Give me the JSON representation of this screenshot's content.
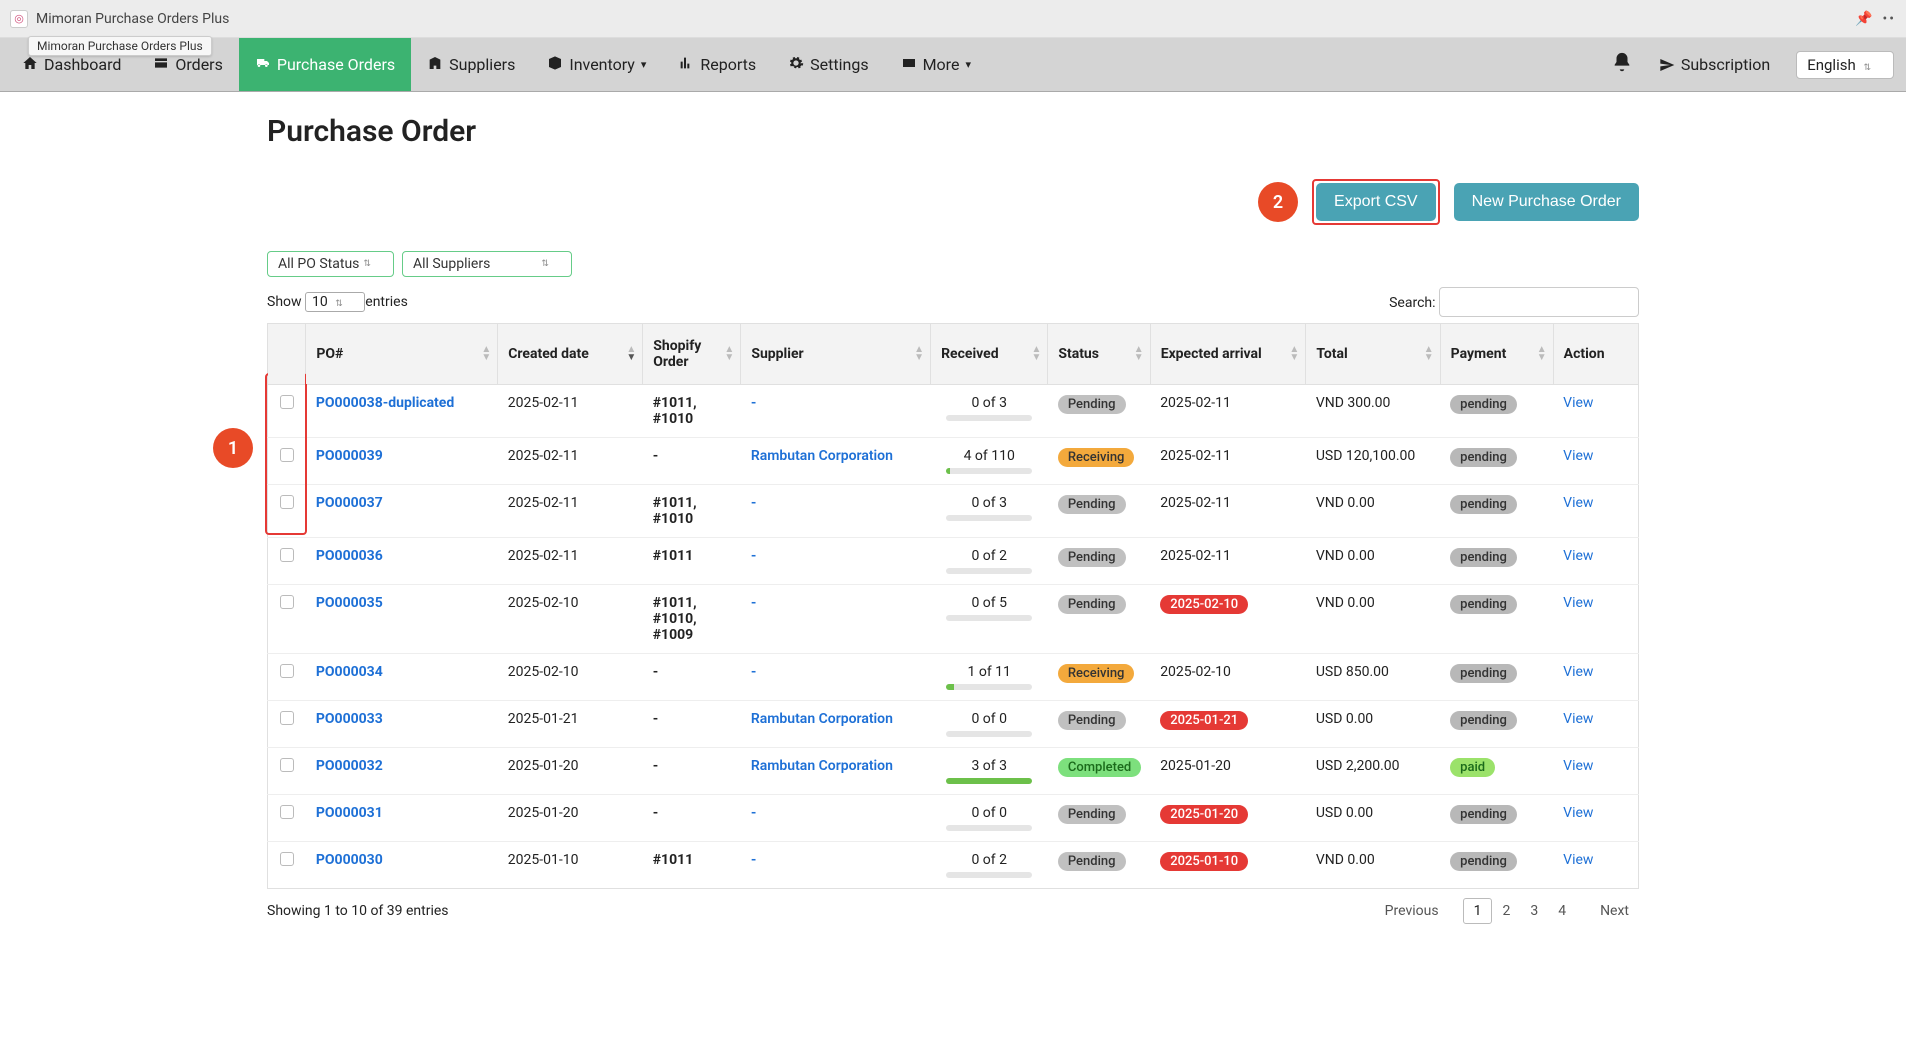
{
  "titlebar": {
    "app_title": "Mimoran Purchase Orders Plus",
    "tooltip": "Mimoran Purchase Orders Plus"
  },
  "nav": {
    "items": [
      {
        "label": "Dashboard",
        "icon": "home-icon"
      },
      {
        "label": "Orders",
        "icon": "orders-icon"
      },
      {
        "label": "Purchase Orders",
        "icon": "truck-icon",
        "active": true
      },
      {
        "label": "Suppliers",
        "icon": "building-icon"
      },
      {
        "label": "Inventory",
        "icon": "box-icon",
        "caret": true
      },
      {
        "label": "Reports",
        "icon": "chart-icon"
      },
      {
        "label": "Settings",
        "icon": "gear-icon"
      },
      {
        "label": "More",
        "icon": "card-icon",
        "caret": true
      }
    ],
    "subscription_label": "Subscription",
    "language": "English"
  },
  "page": {
    "title": "Purchase Order",
    "export_button": "Export CSV",
    "new_button": "New Purchase Order"
  },
  "annotations": {
    "a1": "1",
    "a2": "2"
  },
  "filters": {
    "status_select": "All PO Status",
    "supplier_select": "All Suppliers"
  },
  "datatable": {
    "show_label_prefix": "Show",
    "length_value": "10",
    "show_label_suffix": "entries",
    "search_label": "Search:",
    "columns": [
      "",
      "PO#",
      "Created date",
      "Shopify Order",
      "Supplier",
      "Received",
      "Status",
      "Expected arrival",
      "Total",
      "Payment",
      "Action"
    ],
    "rows": [
      {
        "po": "PO000038-duplicated",
        "created": "2025-02-11",
        "shopify": "#1011, #1010",
        "supplier": "-",
        "received_text": "0 of 3",
        "received_pct": 0,
        "status": "Pending",
        "status_class": "pending",
        "eta": "2025-02-11",
        "eta_overdue": false,
        "total": "VND 300.00",
        "payment": "pending",
        "payment_class": "pending",
        "action": "View"
      },
      {
        "po": "PO000039",
        "created": "2025-02-11",
        "shopify": "-",
        "supplier": "Rambutan Corporation",
        "received_text": "4 of 110",
        "received_pct": 4,
        "status": "Receiving",
        "status_class": "receiving",
        "eta": "2025-02-11",
        "eta_overdue": false,
        "total": "USD 120,100.00",
        "payment": "pending",
        "payment_class": "pending",
        "action": "View"
      },
      {
        "po": "PO000037",
        "created": "2025-02-11",
        "shopify": "#1011, #1010",
        "supplier": "-",
        "received_text": "0 of 3",
        "received_pct": 0,
        "status": "Pending",
        "status_class": "pending",
        "eta": "2025-02-11",
        "eta_overdue": false,
        "total": "VND 0.00",
        "payment": "pending",
        "payment_class": "pending",
        "action": "View"
      },
      {
        "po": "PO000036",
        "created": "2025-02-11",
        "shopify": "#1011",
        "supplier": "-",
        "received_text": "0 of 2",
        "received_pct": 0,
        "status": "Pending",
        "status_class": "pending",
        "eta": "2025-02-11",
        "eta_overdue": false,
        "total": "VND 0.00",
        "payment": "pending",
        "payment_class": "pending",
        "action": "View"
      },
      {
        "po": "PO000035",
        "created": "2025-02-10",
        "shopify": "#1011, #1010, #1009",
        "supplier": "-",
        "received_text": "0 of 5",
        "received_pct": 0,
        "status": "Pending",
        "status_class": "pending",
        "eta": "2025-02-10",
        "eta_overdue": true,
        "total": "VND 0.00",
        "payment": "pending",
        "payment_class": "pending",
        "action": "View"
      },
      {
        "po": "PO000034",
        "created": "2025-02-10",
        "shopify": "-",
        "supplier": "-",
        "received_text": "1 of 11",
        "received_pct": 9,
        "status": "Receiving",
        "status_class": "receiving",
        "eta": "2025-02-10",
        "eta_overdue": false,
        "total": "USD 850.00",
        "payment": "pending",
        "payment_class": "pending",
        "action": "View"
      },
      {
        "po": "PO000033",
        "created": "2025-01-21",
        "shopify": "-",
        "supplier": "Rambutan Corporation",
        "received_text": "0 of 0",
        "received_pct": 0,
        "status": "Pending",
        "status_class": "pending",
        "eta": "2025-01-21",
        "eta_overdue": true,
        "total": "USD 0.00",
        "payment": "pending",
        "payment_class": "pending",
        "action": "View"
      },
      {
        "po": "PO000032",
        "created": "2025-01-20",
        "shopify": "-",
        "supplier": "Rambutan Corporation",
        "received_text": "3 of 3",
        "received_pct": 100,
        "status": "Completed",
        "status_class": "completed",
        "eta": "2025-01-20",
        "eta_overdue": false,
        "total": "USD 2,200.00",
        "payment": "paid",
        "payment_class": "paid",
        "action": "View"
      },
      {
        "po": "PO000031",
        "created": "2025-01-20",
        "shopify": "-",
        "supplier": "-",
        "received_text": "0 of 0",
        "received_pct": 0,
        "status": "Pending",
        "status_class": "pending",
        "eta": "2025-01-20",
        "eta_overdue": true,
        "total": "USD 0.00",
        "payment": "pending",
        "payment_class": "pending",
        "action": "View"
      },
      {
        "po": "PO000030",
        "created": "2025-01-10",
        "shopify": "#1011",
        "supplier": "-",
        "received_text": "0 of 2",
        "received_pct": 0,
        "status": "Pending",
        "status_class": "pending",
        "eta": "2025-01-10",
        "eta_overdue": true,
        "total": "VND 0.00",
        "payment": "pending",
        "payment_class": "pending",
        "action": "View"
      }
    ],
    "info": "Showing 1 to 10 of 39 entries",
    "pager": {
      "previous": "Previous",
      "pages": [
        "1",
        "2",
        "3",
        "4"
      ],
      "next": "Next",
      "current": "1"
    }
  }
}
